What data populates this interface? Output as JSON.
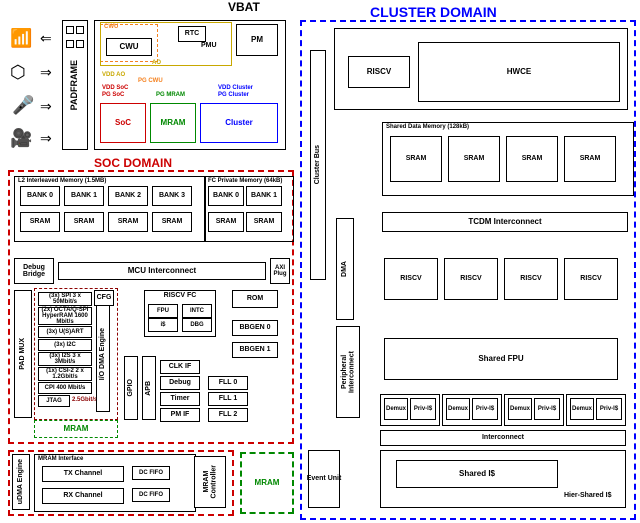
{
  "title_vbat": "VBAT",
  "title_cluster_domain": "CLUSTER DOMAIN",
  "title_soc_domain": "SOC DOMAIN",
  "padframe": "PADFRAME",
  "power": {
    "cwu_outer": "CWU",
    "cwu_inner": "CWU",
    "ao": "AO",
    "rtc": "RTC",
    "pmu": "PMU",
    "pm": "PM",
    "vdd_ao": "VDD AO",
    "pg_cwu": "PG CWU",
    "vdd_soc": "VDD SoC",
    "pg_soc": "PG SoC",
    "vdd_cluster": "VDD Cluster",
    "pg_mram": "PG MRAM",
    "pg_cluster": "PG Cluster",
    "soc": "SoC",
    "mram": "MRAM",
    "cluster": "Cluster"
  },
  "soc": {
    "l2_header": "L2 Interleaved Memory (1.5MB)",
    "fc_header": "FC Private Memory (64kB)",
    "banks": [
      "BANK 0",
      "BANK 1",
      "BANK 2",
      "BANK 3"
    ],
    "fc_banks": [
      "BANK 0",
      "BANK 1"
    ],
    "sram": "SRAM",
    "mcu_interconnect": "MCU Interconnect",
    "debug_bridge": "Debug\nBridge",
    "axi_plug": "AXI\nPlug",
    "cfg": "CFG",
    "riscv_fc": "RISCV FC",
    "fpu": "FPU",
    "intc": "INTC",
    "icache": "i$",
    "dbg": "DBG",
    "rom": "ROM",
    "bbgen0": "BBGEN 0",
    "bbgen1": "BBGEN 1",
    "gpio": "GPIO",
    "apb": "APB",
    "clkif": "CLK IF",
    "debug": "Debug",
    "timer": "Timer",
    "pmif": "PM IF",
    "fll0": "FLL 0",
    "fll1": "FLL 1",
    "fll2": "FLL 2",
    "pad_mux": "PAD MUX",
    "io_dma": "I/O DMA Engine",
    "mram_block": "MRAM",
    "io_list": [
      "(3x) SPI\n3 x 50Mbit/s",
      "(2x) OCTA/Q-SPI\nHyperRAM\n1600 Mbit/s",
      "(3x) U(S)ART",
      "(3x) I2C",
      "(3x) I2S\n3 x 3Mbit/s",
      "(1x) CSI-2\n2 x 1.2Gbit/s",
      "CPI 400 Mbit/s",
      "JTAG",
      "2.5Gbit/s"
    ]
  },
  "mram_if": {
    "udma": "uDMA Engine",
    "header": "MRAM Interface",
    "tx": "TX Channel",
    "rx": "RX Channel",
    "dcfifo": "DC FIFO",
    "mram_ctrl": "MRAM\nController",
    "mram": "MRAM"
  },
  "cluster": {
    "riscv": "RISCV",
    "hwce": "HWCE",
    "cluster_bus": "Cluster Bus",
    "dma": "DMA",
    "periph": "Peripheral\nInterconnect",
    "sdm_header": "Shared Data Memory (128kB)",
    "sram": "SRAM",
    "tcdm": "TCDM Interconnect",
    "shared_fpu": "Shared FPU",
    "event_unit": "Event Unit",
    "interconnect": "Interconnect",
    "demux": "Demux",
    "priv": "Priv-I$",
    "shared_i": "Shared I$",
    "hier": "Hier-Shared I$"
  }
}
